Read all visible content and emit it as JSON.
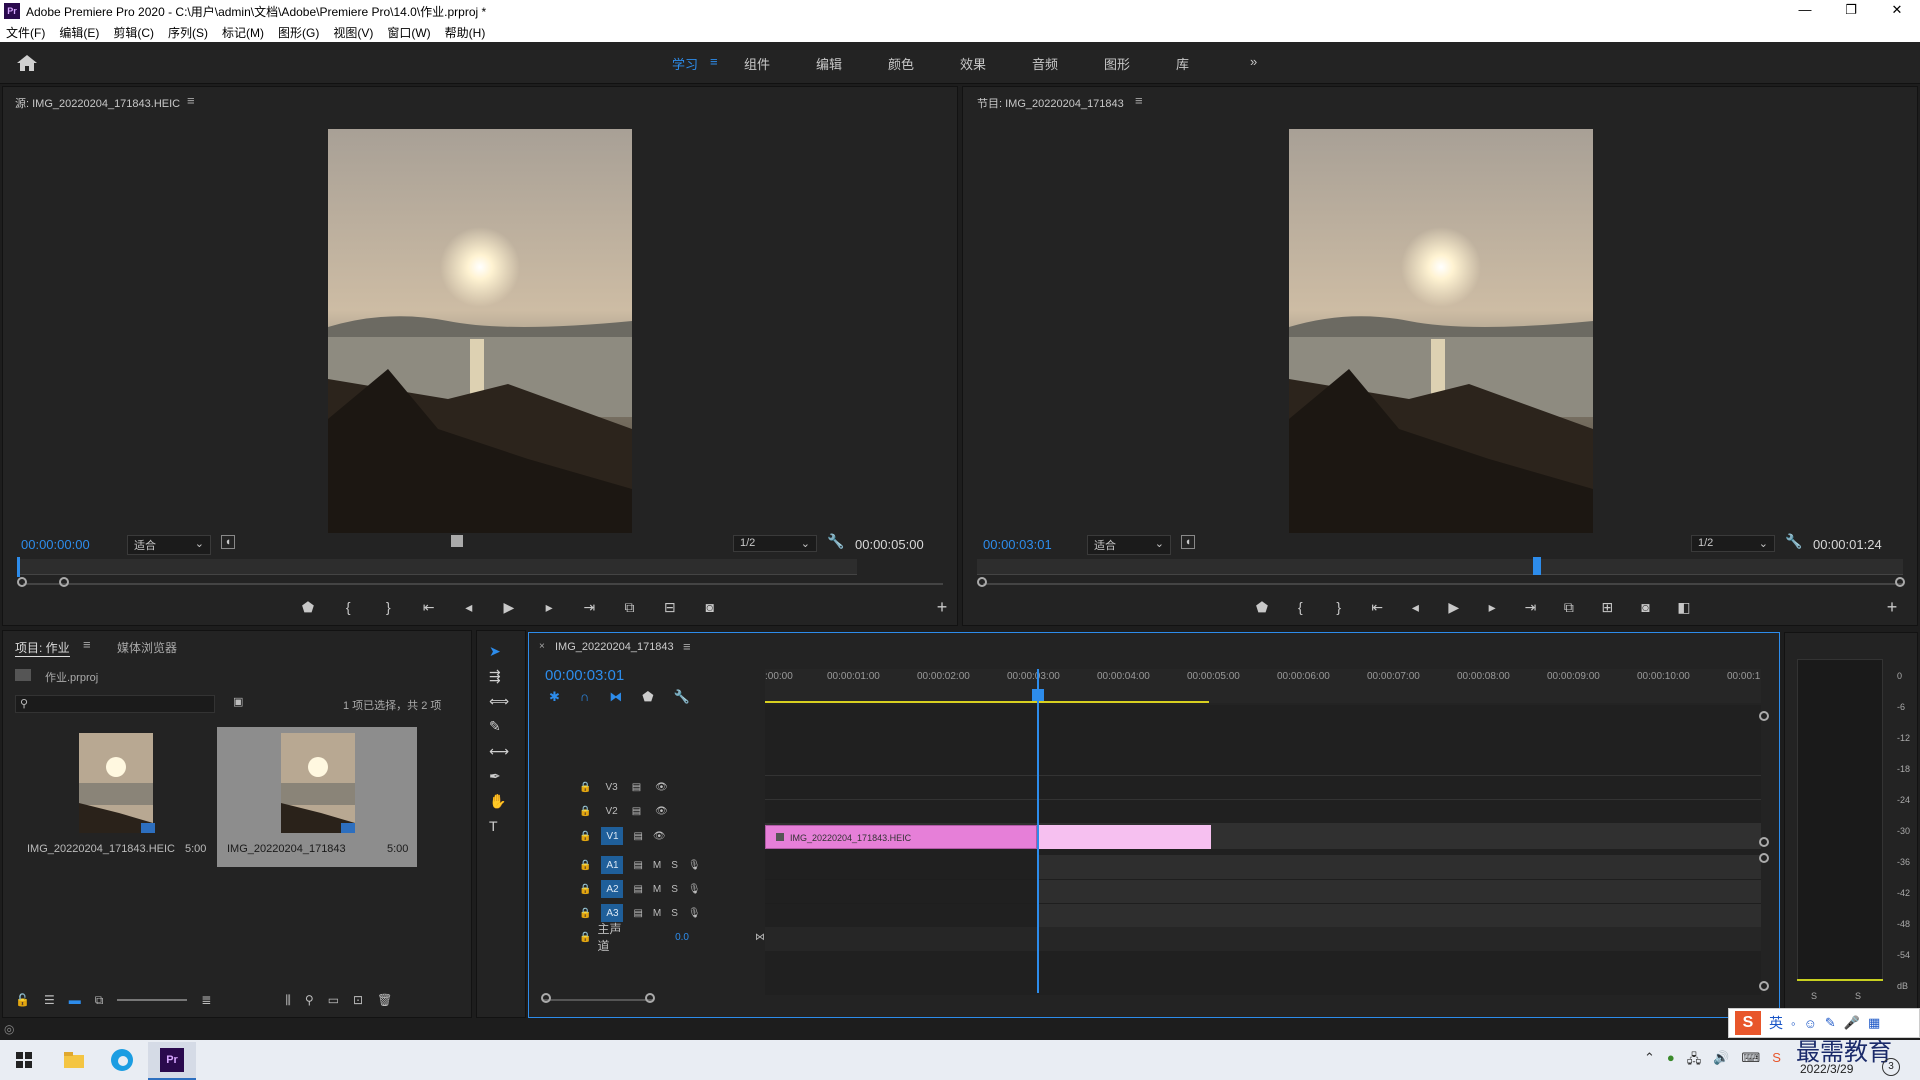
{
  "app": {
    "title": "Adobe Premiere Pro 2020 - C:\\用户\\admin\\文档\\Adobe\\Premiere Pro\\14.0\\作业.prproj *",
    "logo": "Pr"
  },
  "menu": [
    "文件(F)",
    "编辑(E)",
    "剪辑(C)",
    "序列(S)",
    "标记(M)",
    "图形(G)",
    "视图(V)",
    "窗口(W)",
    "帮助(H)"
  ],
  "workspaces": [
    "学习",
    "组件",
    "编辑",
    "颜色",
    "效果",
    "音频",
    "图形",
    "库"
  ],
  "workspace_more": "»",
  "source": {
    "title": "源: IMG_20220204_171843.HEIC",
    "timecode": "00:00:00:00",
    "fit": "适合",
    "resolution": "1/2",
    "duration": "00:00:05:00",
    "playhead_fraction": 0.0
  },
  "program": {
    "title": "节目: IMG_20220204_171843",
    "timecode": "00:00:03:01",
    "fit": "适合",
    "resolution": "1/2",
    "duration": "00:00:01:24",
    "playhead_fraction": 0.6
  },
  "project": {
    "tab_project": "项目: 作业",
    "tab_media": "媒体浏览器",
    "file": "作业.prproj",
    "selection_info": "1 项已选择，共 2 项",
    "items": [
      {
        "name": "IMG_20220204_171843.HEIC",
        "duration": "5:00"
      },
      {
        "name": "IMG_20220204_171843",
        "duration": "5:00"
      }
    ]
  },
  "timeline": {
    "tab": "IMG_20220204_171843",
    "timecode": "00:00:03:01",
    "ruler": [
      ":00:00",
      "00:00:01:00",
      "00:00:02:00",
      "00:00:03:00",
      "00:00:04:00",
      "00:00:05:00",
      "00:00:06:00",
      "00:00:07:00",
      "00:00:08:00",
      "00:00:09:00",
      "00:00:10:00",
      "00:00:1"
    ],
    "video_tracks": [
      "V3",
      "V2",
      "V1"
    ],
    "audio_tracks": [
      "A1",
      "A2",
      "A3"
    ],
    "master": "主声道",
    "master_value": "0.0",
    "clip_name": "IMG_20220204_171843.HEIC",
    "m_label": "M",
    "s_label": "S"
  },
  "meter": {
    "ticks": [
      "0",
      "-6",
      "-12",
      "-18",
      "-24",
      "-30",
      "-36",
      "-42",
      "-48",
      "-54",
      "dB"
    ],
    "s_labels": [
      "S",
      "S"
    ]
  },
  "tray": {
    "lang": "英",
    "watermark": "最需教育",
    "date": "2022/3/29",
    "badge": "3"
  },
  "colors": {
    "accent": "#2d8ceb",
    "clip_pink": "#e67fd8",
    "clip_light_pink": "#f6c0f0"
  }
}
